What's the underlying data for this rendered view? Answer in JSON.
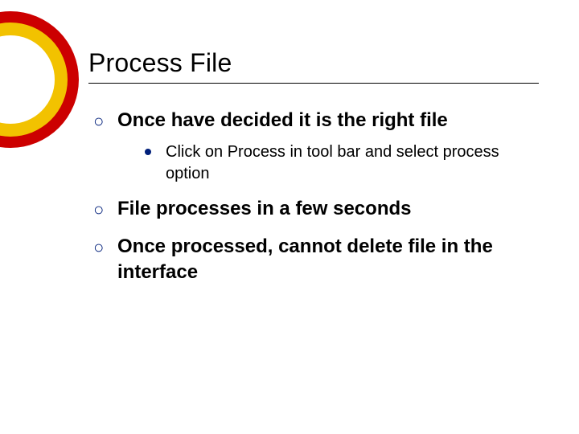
{
  "colors": {
    "accent": "#001f7a",
    "red": "#cc0000",
    "yellow": "#f2c200"
  },
  "title": "Process File",
  "bullets": [
    {
      "text": "Once have decided it is the right file",
      "sub": [
        "Click on Process in tool bar and select process option"
      ]
    },
    {
      "text": "File processes in a few seconds"
    },
    {
      "text": "Once processed, cannot delete file in the interface"
    }
  ]
}
